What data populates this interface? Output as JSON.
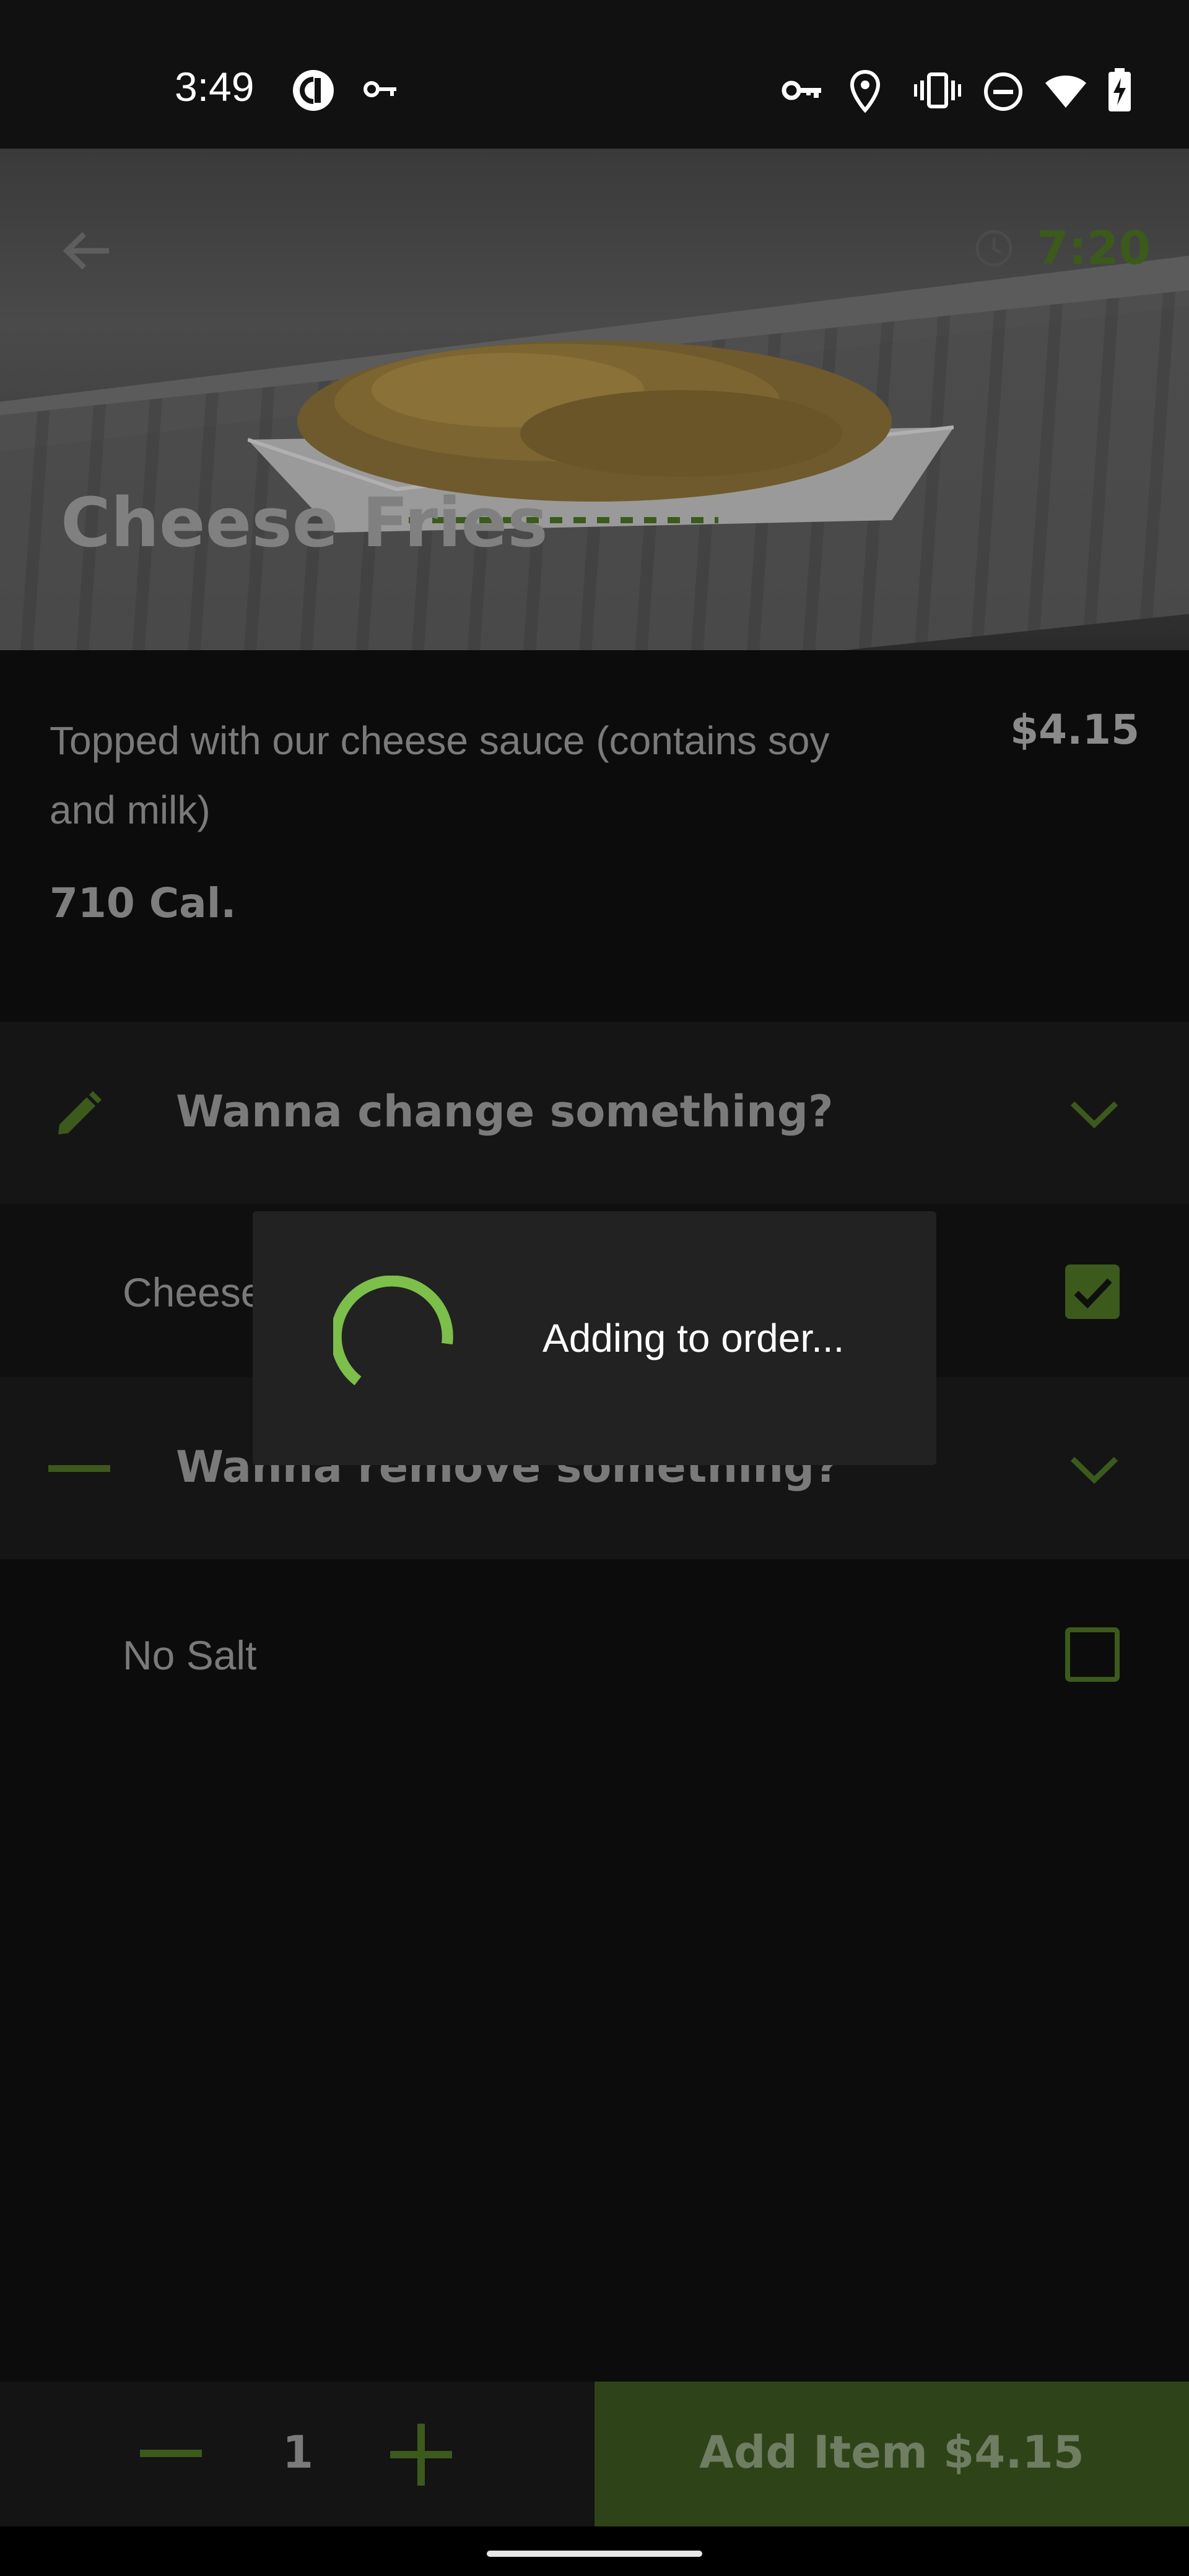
{
  "status_bar": {
    "time": "3:49",
    "left_icons": [
      "pocket-casts-icon",
      "vpn-key-icon"
    ],
    "right_icons": [
      "key-icon",
      "location-icon",
      "vibrate-icon",
      "do-not-disturb-icon",
      "wifi-icon",
      "battery-charging-icon"
    ]
  },
  "header": {
    "title": "Cheese Fries",
    "timer": "7:20",
    "back_icon": "arrow-back-icon",
    "timer_icon": "clock-icon"
  },
  "item": {
    "description": "Topped with our cheese sauce (contains soy and milk)",
    "price": "$4.15",
    "calories": "710 Cal."
  },
  "sections": {
    "change": {
      "title": "Wanna change something?",
      "icon": "pencil-icon",
      "options": [
        {
          "label": "Cheese",
          "checked": true
        }
      ]
    },
    "remove": {
      "title": "Wanna remove something?",
      "icon": "minus-icon",
      "options": [
        {
          "label": "No Salt",
          "checked": false
        }
      ]
    }
  },
  "bottom_bar": {
    "quantity": "1",
    "add_label": "Add Item $4.15"
  },
  "dialog": {
    "message": "Adding to order..."
  },
  "colors": {
    "accent": "#7cbf4a",
    "accent_dim": "#3b5a1c",
    "button_bg": "#2e4418",
    "dialog_bg": "#222222"
  }
}
